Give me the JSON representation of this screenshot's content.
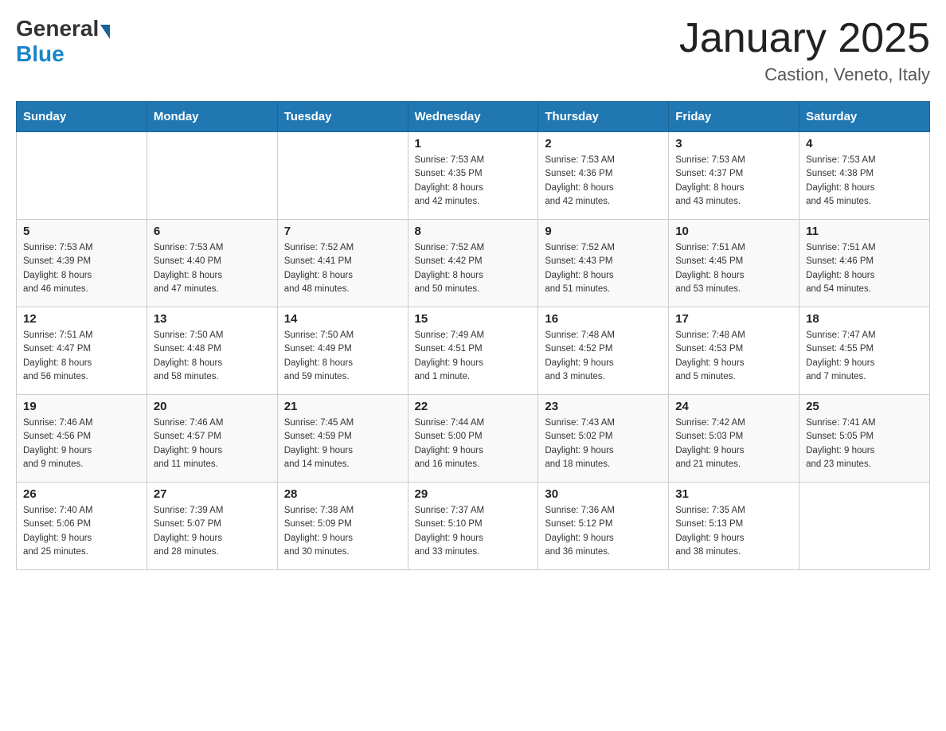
{
  "header": {
    "logo_general": "General",
    "logo_blue": "Blue",
    "month_title": "January 2025",
    "location": "Castion, Veneto, Italy"
  },
  "columns": [
    "Sunday",
    "Monday",
    "Tuesday",
    "Wednesday",
    "Thursday",
    "Friday",
    "Saturday"
  ],
  "weeks": [
    {
      "days": [
        {
          "num": "",
          "info": ""
        },
        {
          "num": "",
          "info": ""
        },
        {
          "num": "",
          "info": ""
        },
        {
          "num": "1",
          "info": "Sunrise: 7:53 AM\nSunset: 4:35 PM\nDaylight: 8 hours\nand 42 minutes."
        },
        {
          "num": "2",
          "info": "Sunrise: 7:53 AM\nSunset: 4:36 PM\nDaylight: 8 hours\nand 42 minutes."
        },
        {
          "num": "3",
          "info": "Sunrise: 7:53 AM\nSunset: 4:37 PM\nDaylight: 8 hours\nand 43 minutes."
        },
        {
          "num": "4",
          "info": "Sunrise: 7:53 AM\nSunset: 4:38 PM\nDaylight: 8 hours\nand 45 minutes."
        }
      ]
    },
    {
      "days": [
        {
          "num": "5",
          "info": "Sunrise: 7:53 AM\nSunset: 4:39 PM\nDaylight: 8 hours\nand 46 minutes."
        },
        {
          "num": "6",
          "info": "Sunrise: 7:53 AM\nSunset: 4:40 PM\nDaylight: 8 hours\nand 47 minutes."
        },
        {
          "num": "7",
          "info": "Sunrise: 7:52 AM\nSunset: 4:41 PM\nDaylight: 8 hours\nand 48 minutes."
        },
        {
          "num": "8",
          "info": "Sunrise: 7:52 AM\nSunset: 4:42 PM\nDaylight: 8 hours\nand 50 minutes."
        },
        {
          "num": "9",
          "info": "Sunrise: 7:52 AM\nSunset: 4:43 PM\nDaylight: 8 hours\nand 51 minutes."
        },
        {
          "num": "10",
          "info": "Sunrise: 7:51 AM\nSunset: 4:45 PM\nDaylight: 8 hours\nand 53 minutes."
        },
        {
          "num": "11",
          "info": "Sunrise: 7:51 AM\nSunset: 4:46 PM\nDaylight: 8 hours\nand 54 minutes."
        }
      ]
    },
    {
      "days": [
        {
          "num": "12",
          "info": "Sunrise: 7:51 AM\nSunset: 4:47 PM\nDaylight: 8 hours\nand 56 minutes."
        },
        {
          "num": "13",
          "info": "Sunrise: 7:50 AM\nSunset: 4:48 PM\nDaylight: 8 hours\nand 58 minutes."
        },
        {
          "num": "14",
          "info": "Sunrise: 7:50 AM\nSunset: 4:49 PM\nDaylight: 8 hours\nand 59 minutes."
        },
        {
          "num": "15",
          "info": "Sunrise: 7:49 AM\nSunset: 4:51 PM\nDaylight: 9 hours\nand 1 minute."
        },
        {
          "num": "16",
          "info": "Sunrise: 7:48 AM\nSunset: 4:52 PM\nDaylight: 9 hours\nand 3 minutes."
        },
        {
          "num": "17",
          "info": "Sunrise: 7:48 AM\nSunset: 4:53 PM\nDaylight: 9 hours\nand 5 minutes."
        },
        {
          "num": "18",
          "info": "Sunrise: 7:47 AM\nSunset: 4:55 PM\nDaylight: 9 hours\nand 7 minutes."
        }
      ]
    },
    {
      "days": [
        {
          "num": "19",
          "info": "Sunrise: 7:46 AM\nSunset: 4:56 PM\nDaylight: 9 hours\nand 9 minutes."
        },
        {
          "num": "20",
          "info": "Sunrise: 7:46 AM\nSunset: 4:57 PM\nDaylight: 9 hours\nand 11 minutes."
        },
        {
          "num": "21",
          "info": "Sunrise: 7:45 AM\nSunset: 4:59 PM\nDaylight: 9 hours\nand 14 minutes."
        },
        {
          "num": "22",
          "info": "Sunrise: 7:44 AM\nSunset: 5:00 PM\nDaylight: 9 hours\nand 16 minutes."
        },
        {
          "num": "23",
          "info": "Sunrise: 7:43 AM\nSunset: 5:02 PM\nDaylight: 9 hours\nand 18 minutes."
        },
        {
          "num": "24",
          "info": "Sunrise: 7:42 AM\nSunset: 5:03 PM\nDaylight: 9 hours\nand 21 minutes."
        },
        {
          "num": "25",
          "info": "Sunrise: 7:41 AM\nSunset: 5:05 PM\nDaylight: 9 hours\nand 23 minutes."
        }
      ]
    },
    {
      "days": [
        {
          "num": "26",
          "info": "Sunrise: 7:40 AM\nSunset: 5:06 PM\nDaylight: 9 hours\nand 25 minutes."
        },
        {
          "num": "27",
          "info": "Sunrise: 7:39 AM\nSunset: 5:07 PM\nDaylight: 9 hours\nand 28 minutes."
        },
        {
          "num": "28",
          "info": "Sunrise: 7:38 AM\nSunset: 5:09 PM\nDaylight: 9 hours\nand 30 minutes."
        },
        {
          "num": "29",
          "info": "Sunrise: 7:37 AM\nSunset: 5:10 PM\nDaylight: 9 hours\nand 33 minutes."
        },
        {
          "num": "30",
          "info": "Sunrise: 7:36 AM\nSunset: 5:12 PM\nDaylight: 9 hours\nand 36 minutes."
        },
        {
          "num": "31",
          "info": "Sunrise: 7:35 AM\nSunset: 5:13 PM\nDaylight: 9 hours\nand 38 minutes."
        },
        {
          "num": "",
          "info": ""
        }
      ]
    }
  ]
}
